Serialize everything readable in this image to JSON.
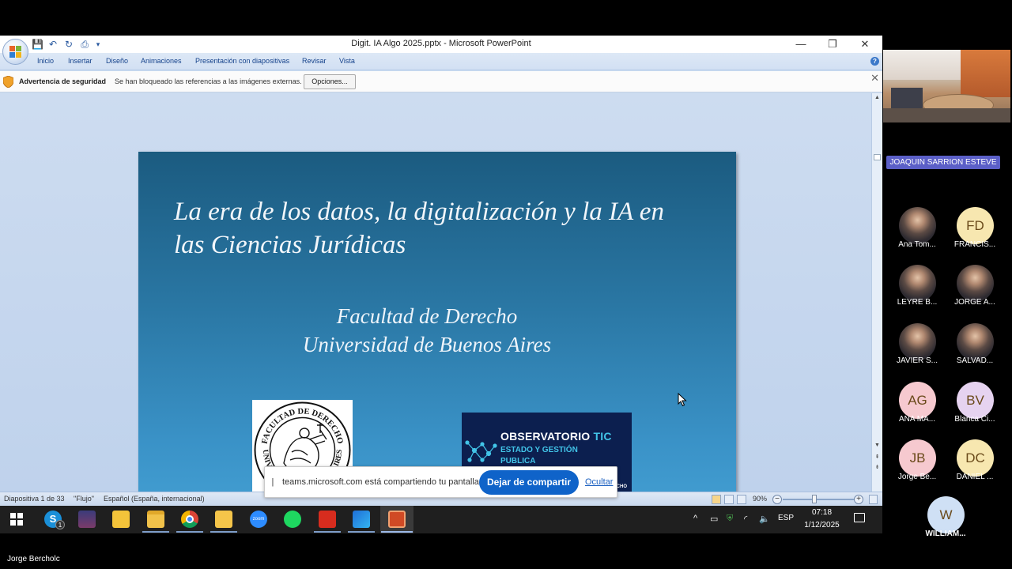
{
  "window": {
    "title": "Digit. IA Algo 2025.pptx - Microsoft PowerPoint",
    "minimize": "—",
    "restore": "❐",
    "close": "✕"
  },
  "menu": [
    "Inicio",
    "Insertar",
    "Diseño",
    "Animaciones",
    "Presentación con diapositivas",
    "Revisar",
    "Vista"
  ],
  "security_bar": {
    "title": "Advertencia de seguridad",
    "message": "Se han bloqueado las referencias a las imágenes externas.",
    "options_label": "Opciones..."
  },
  "slide": {
    "title": "La era de los datos, la digitalización y la IA en\nlas Ciencias Jurídicas",
    "subtitle": "Facultad de Derecho\nUniversidad de Buenos Aires",
    "seal_text_top": "FACULTAD DE DERECHO",
    "seal_text_bottom": "UNIVERSIDAD DE BUENOS AIRES",
    "logo": {
      "line1": "OBSERVATORIO",
      "line1_accent": "TIC",
      "line2": "ESTADO Y GESTIÓN\nPUBLICA",
      "footer": "UBA DERECHO"
    }
  },
  "status_bar": {
    "slide_counter": "Diapositiva 1 de 33",
    "theme": "\"Flujo\"",
    "language": "Español (España, internacional)",
    "zoom": "90%"
  },
  "share_notice": {
    "message": "teams.microsoft.com está compartiendo tu pantalla.",
    "stop_label": "Dejar de compartir",
    "hide_label": "Ocultar"
  },
  "taskbar": {
    "skype_badge": "1",
    "zoom_label": "zoom",
    "tray_lang": "ESP",
    "time": "07:18",
    "date": "1/12/2025"
  },
  "presenter_name": "Jorge Bercholc",
  "meeting": {
    "speaker_label": "JOAQUIN SARRION ESTEVE",
    "participants": [
      {
        "initials": "",
        "name": "Ana Tom...",
        "color": "#d9d9d9",
        "photo": true
      },
      {
        "initials": "FD",
        "name": "FRANCIS...",
        "color": "#f7e7b0",
        "photo": false
      },
      {
        "initials": "",
        "name": "LEYRE B...",
        "color": "#d9d9d9",
        "photo": true
      },
      {
        "initials": "",
        "name": "JORGE A...",
        "color": "#d9d9d9",
        "photo": true
      },
      {
        "initials": "",
        "name": "JAVIER S...",
        "color": "#d9d9d9",
        "photo": true
      },
      {
        "initials": "",
        "name": "SALVAD...",
        "color": "#d9d9d9",
        "photo": true
      },
      {
        "initials": "AG",
        "name": "ANA MA...",
        "color": "#f6c9cf",
        "photo": false
      },
      {
        "initials": "BV",
        "name": "Blanca Ci...",
        "color": "#e6d3f0",
        "photo": false
      },
      {
        "initials": "JB",
        "name": "Jorge Be...",
        "color": "#f6c9cf",
        "photo": false
      },
      {
        "initials": "DC",
        "name": "DANIEL ...",
        "color": "#f7e7b0",
        "photo": false
      },
      {
        "initials": "W",
        "name": "WILLIAM...",
        "color": "#cfe0f5",
        "photo": false
      }
    ]
  }
}
